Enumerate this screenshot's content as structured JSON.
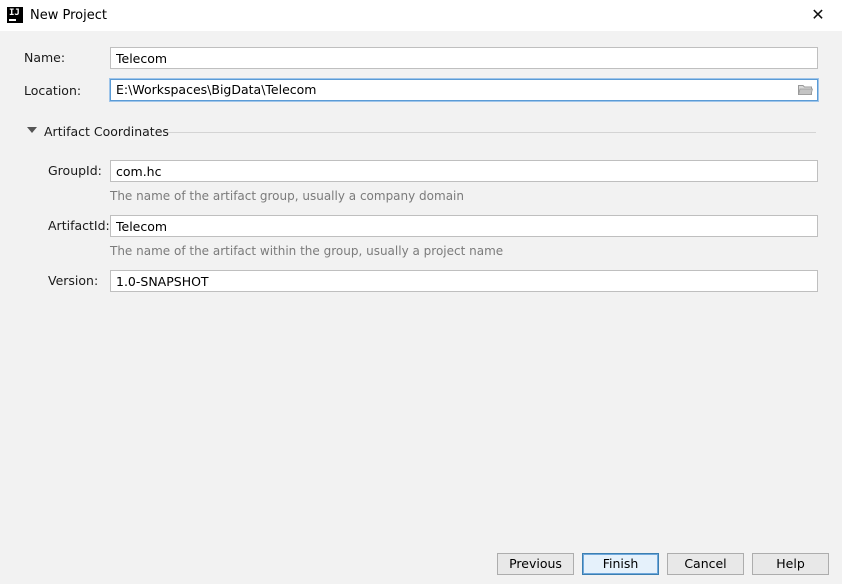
{
  "window": {
    "title": "New Project",
    "close_symbol": "✕"
  },
  "form": {
    "name_label": "Name:",
    "name_value": "Telecom",
    "location_label": "Location:",
    "location_value": "E:\\Workspaces\\BigData\\Telecom"
  },
  "artifact": {
    "section_title": "Artifact Coordinates",
    "expanded": true,
    "group_label": "GroupId:",
    "group_value": "com.hc",
    "group_hint": "The name of the artifact group, usually a company domain",
    "artifact_label": "ArtifactId:",
    "artifact_value": "Telecom",
    "artifact_hint": "The name of the artifact within the group, usually a project name",
    "version_label": "Version:",
    "version_value": "1.0-SNAPSHOT"
  },
  "buttons": {
    "previous": "Previous",
    "finish": "Finish",
    "cancel": "Cancel",
    "help": "Help"
  },
  "colors": {
    "focus_border": "#5b9bd5",
    "hint_text": "#7b7b7b",
    "default_button_border": "#3c7fb1"
  },
  "icons": {
    "app": "intellij-idea-icon",
    "close": "close-icon",
    "browse": "folder-icon",
    "section_toggle": "triangle-down-icon"
  }
}
